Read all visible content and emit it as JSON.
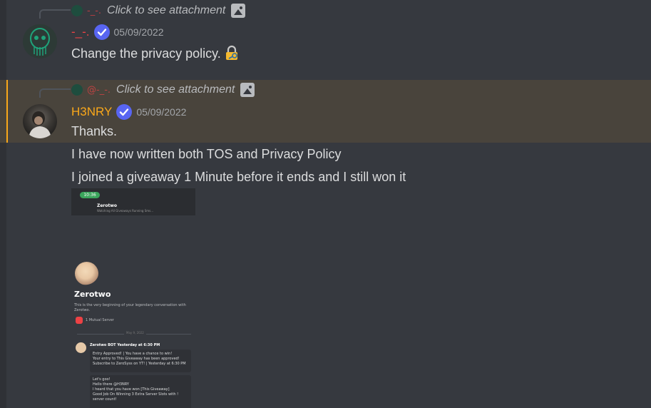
{
  "colors": {
    "accent": "#faa81a",
    "verified": "#5865f2",
    "h3nry": "#faa81a",
    "user1": "#ed4245"
  },
  "messages": [
    {
      "reply": {
        "author": "-_-.",
        "text": "Click to see attachment",
        "icon": "image-icon"
      },
      "author": "-_-.",
      "verified_icon": "verified-badge-icon",
      "timestamp": "05/09/2022",
      "text": "Change the privacy policy.",
      "emoji": "lock-key-icon"
    },
    {
      "reply": {
        "author": "@-_-.",
        "text": "Click to see attachment",
        "icon": "image-icon"
      },
      "author": "H3NRY",
      "verified_icon": "verified-badge-icon",
      "timestamp": "05/09/2022",
      "lines": [
        "Thanks.",
        "I have now written both TOS and Privacy Policy",
        "I joined a giveaway 1 Minute before it ends and I still won it"
      ]
    }
  ],
  "attachment": {
    "status_time": "10:36",
    "channel_name": "Zerotwo",
    "channel_sub": "Watching All Giveaways Running Sms...",
    "profile_name": "Zerotwo",
    "profile_desc": "This is the very beginning of your legendary conversation with Zerotwo.",
    "mutual": "1 Mutual Server",
    "date_divider": "May 9, 2022",
    "bot_name": "Zerotwo BOT Yesterday at 6:30 PM",
    "card1": [
      "Entry Approved! | You have a chance to win!",
      "Your entry to This Giveaway has been approved!",
      "Subscribe to ZeroSyss on YT! | Yesterday at 6:30 PM"
    ],
    "card2": [
      "Let's goo!",
      "Hello there @H3NRY",
      "I heard that you have won [This Giveaway]",
      "Good Job On Winning 3 Extra Server Slots with !",
      "server count!"
    ]
  }
}
